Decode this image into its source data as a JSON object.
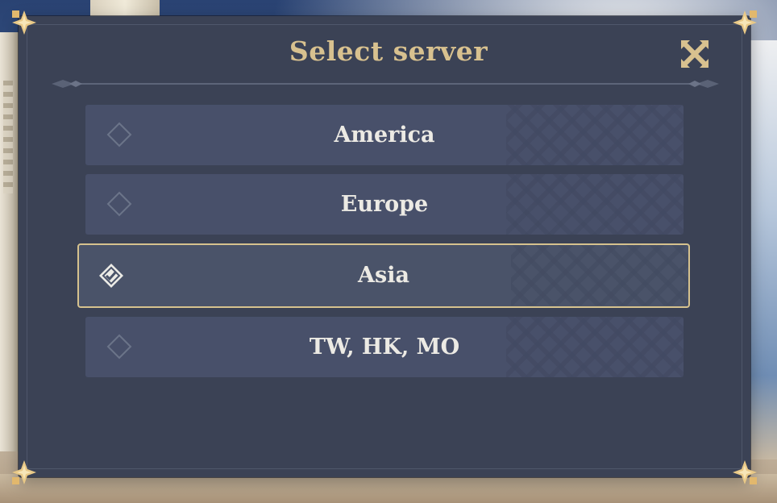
{
  "dialog": {
    "title": "Select server",
    "close_icon": "close-x-icon"
  },
  "servers": [
    {
      "label": "America",
      "selected": false
    },
    {
      "label": "Europe",
      "selected": false
    },
    {
      "label": "Asia",
      "selected": true
    },
    {
      "label": "TW, HK, MO",
      "selected": false
    }
  ],
  "colors": {
    "panel": "#3b4255",
    "item": "#48506a",
    "accent_gold": "#d8c18f",
    "text": "#eceae4"
  }
}
